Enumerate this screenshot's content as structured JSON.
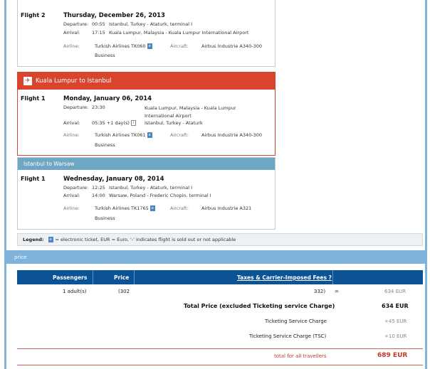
{
  "flight_outbound_2": {
    "label": "Flight 2",
    "date": "Thursday, December 26, 2013",
    "departure_label": "Departure:",
    "departure_time": "00:55",
    "departure_place": "Istanbul, Turkey - Ataturk, terminal I",
    "arrival_label": "Arrival:",
    "arrival_time": "17:15",
    "arrival_place": "Kuala Lumpur, Malaysia - Kuala Lumpur International Airport",
    "airline_label": "Airline:",
    "airline": "Turkish Airlines TK060",
    "class": "Business",
    "aircraft_label": "Aircraft:",
    "aircraft": "Airbus Industrie A340-300"
  },
  "segment_kl_ist": {
    "header": "Kuala Lumpur to Istanbul",
    "label": "Flight 1",
    "date": "Monday, January 06, 2014",
    "departure_label": "Departure:",
    "departure_time": "23:30",
    "departure_place": "Kuala Lumpur, Malaysia - Kuala Lumpur International Airport",
    "arrival_label": "Arrival:",
    "arrival_time": "05:35 +1 day(s)",
    "arrival_place": "Istanbul, Turkey - Ataturk",
    "airline_label": "Airline:",
    "airline": "Turkish Airlines TK061",
    "class": "Business",
    "aircraft_label": "Aircraft:",
    "aircraft": "Airbus Industrie A340-300"
  },
  "segment_ist_waw": {
    "header": "Istanbul to Warsaw",
    "label": "Flight 1",
    "date": "Wednesday, January 08, 2014",
    "departure_label": "Departure:",
    "departure_time": "12:25",
    "departure_place": "Istanbul, Turkey - Ataturk, terminal I",
    "arrival_label": "Arrival:",
    "arrival_time": "14:00",
    "arrival_place": "Warsaw, Poland - Frederic Chopin, terminal I",
    "airline_label": "Airline:",
    "airline": "Turkish Airlines TK1765",
    "class": "Business",
    "aircraft_label": "Aircraft:",
    "aircraft": "Airbus Industrie A321"
  },
  "legend": {
    "title": "Legend:",
    "etk": "e",
    "text": "= electronic ticket,   EUR = Euro, '-' indicates flight is sold out or not applicable"
  },
  "price": {
    "section_title": "price",
    "col_passengers": "Passengers",
    "col_price": "Price",
    "col_taxes": "Taxes & Carrier-Imposed Fees ?",
    "row_passengers": "1 adult(s)",
    "row_price": "(302",
    "row_taxes": "332)",
    "row_eq": "=",
    "row_total": "634 EUR",
    "total_label": "Total Price (excluded Ticketing service Charge)",
    "total_value": "634 EUR",
    "tsc1_label": "Ticketing Service Charge",
    "tsc1_value": "+45 EUR",
    "tsc2_label": "Ticketing Service Charge (TSC)",
    "tsc2_value": "+10 EUR",
    "final_label": "total for all travellers",
    "final_value": "689 EUR"
  },
  "colors": {
    "accent_red": "#d9452c",
    "header_blue": "#0b5394",
    "section_blue": "#7fb3dc"
  }
}
